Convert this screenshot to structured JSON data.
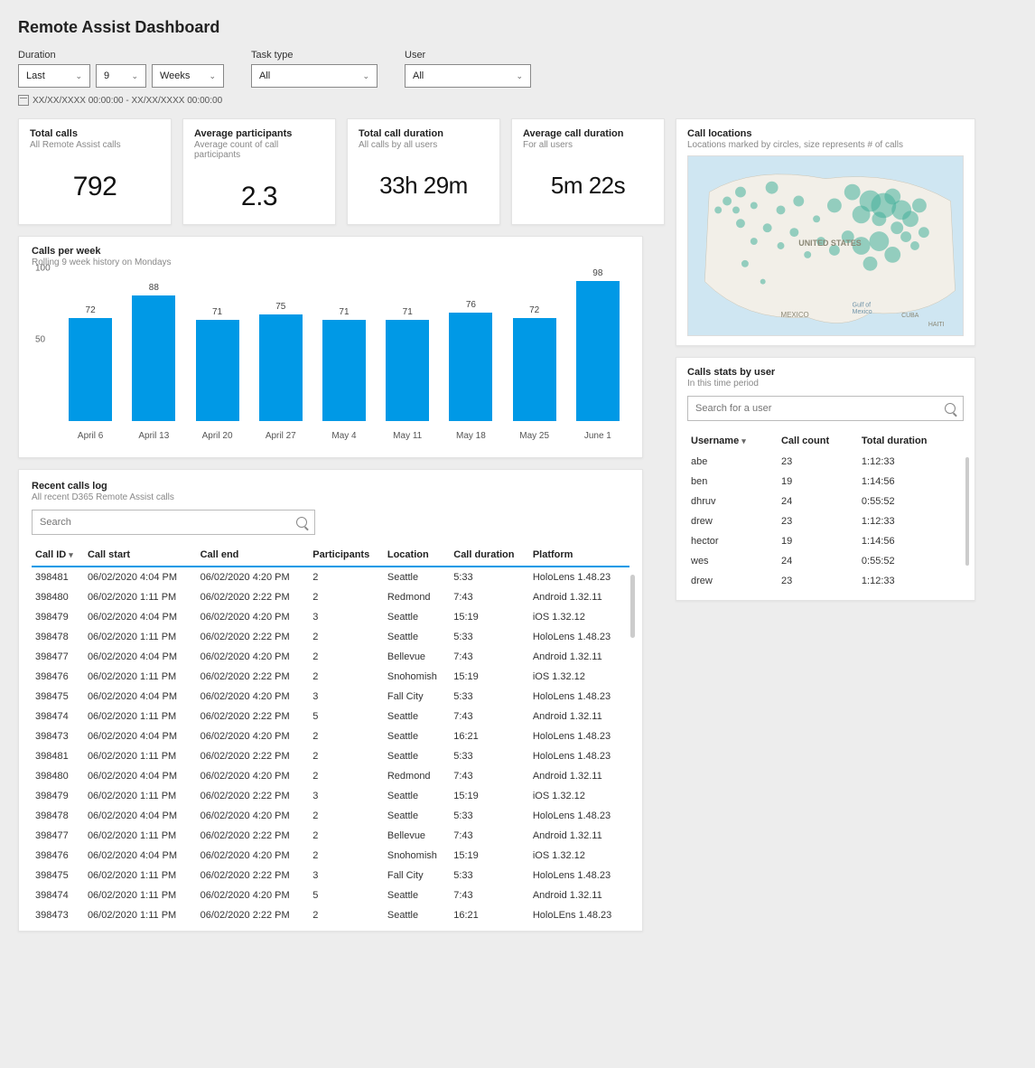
{
  "title": "Remote Assist Dashboard",
  "filters": {
    "duration_label": "Duration",
    "duration_mode": "Last",
    "duration_num": "9",
    "duration_unit": "Weeks",
    "tasktype_label": "Task type",
    "tasktype_val": "All",
    "user_label": "User",
    "user_val": "All"
  },
  "date_range": "XX/XX/XXXX 00:00:00 - XX/XX/XXXX 00:00:00",
  "stats": {
    "total_calls": {
      "title": "Total calls",
      "sub": "All Remote Assist calls",
      "val": "792"
    },
    "avg_part": {
      "title": "Average participants",
      "sub": "Average count of call participants",
      "val": "2.3"
    },
    "total_dur": {
      "title": "Total call duration",
      "sub": "All calls by all users",
      "val": "33h 29m"
    },
    "avg_dur": {
      "title": "Average call duration",
      "sub": "For all users",
      "val": "5m 22s"
    }
  },
  "map": {
    "title": "Call locations",
    "sub": "Locations marked by circles, size represents # of calls",
    "label_us": "UNITED STATES",
    "label_mx": "MEXICO",
    "label_gom": "Gulf of",
    "label_gom2": "Mexico",
    "label_cuba": "CUBA",
    "label_haiti": "HAITI"
  },
  "user_stats": {
    "title": "Calls stats by user",
    "sub": "In this time period",
    "search_ph": "Search for a user",
    "h1": "Username",
    "h2": "Call count",
    "h3": "Total duration",
    "rows": [
      {
        "u": "abe",
        "c": "23",
        "d": "1:12:33"
      },
      {
        "u": "ben",
        "c": "19",
        "d": "1:14:56"
      },
      {
        "u": "dhruv",
        "c": "24",
        "d": "0:55:52"
      },
      {
        "u": "drew",
        "c": "23",
        "d": "1:12:33"
      },
      {
        "u": "hector",
        "c": "19",
        "d": "1:14:56"
      },
      {
        "u": "wes",
        "c": "24",
        "d": "0:55:52"
      },
      {
        "u": "drew",
        "c": "23",
        "d": "1:12:33"
      }
    ]
  },
  "chart": {
    "title": "Calls per week",
    "sub": "Rolling 9 week history on Mondays",
    "ymax": 100,
    "ticks": [
      50,
      100
    ],
    "bars": [
      {
        "x": "April 6",
        "v": 72
      },
      {
        "x": "April 13",
        "v": 88
      },
      {
        "x": "April 20",
        "v": 71
      },
      {
        "x": "April 27",
        "v": 75
      },
      {
        "x": "May 4",
        "v": 71
      },
      {
        "x": "May 11",
        "v": 71
      },
      {
        "x": "May 18",
        "v": 76
      },
      {
        "x": "May 25",
        "v": 72
      },
      {
        "x": "June 1",
        "v": 98
      }
    ]
  },
  "chart_data": {
    "type": "bar",
    "title": "Calls per week",
    "subtitle": "Rolling 9 week history on Mondays",
    "xlabel": "",
    "ylabel": "",
    "ylim": [
      0,
      100
    ],
    "categories": [
      "April 6",
      "April 13",
      "April 20",
      "April 27",
      "May 4",
      "May 11",
      "May 18",
      "May 25",
      "June 1"
    ],
    "values": [
      72,
      88,
      71,
      75,
      71,
      71,
      76,
      72,
      98
    ]
  },
  "log": {
    "title": "Recent calls log",
    "sub": "All recent D365 Remote Assist calls",
    "search_ph": "Search",
    "headers": [
      "Call ID",
      "Call start",
      "Call end",
      "Participants",
      "Location",
      "Call duration",
      "Platform"
    ],
    "rows": [
      [
        "398481",
        "06/02/2020 4:04 PM",
        "06/02/2020 4:20 PM",
        "2",
        "Seattle",
        "5:33",
        "HoloLens 1.48.23"
      ],
      [
        "398480",
        "06/02/2020 1:11 PM",
        "06/02/2020 2:22 PM",
        "2",
        "Redmond",
        "7:43",
        "Android 1.32.11"
      ],
      [
        "398479",
        "06/02/2020 4:04 PM",
        "06/02/2020 4:20 PM",
        "3",
        "Seattle",
        "15:19",
        "iOS 1.32.12"
      ],
      [
        "398478",
        "06/02/2020 1:11 PM",
        "06/02/2020 2:22 PM",
        "2",
        "Seattle",
        "5:33",
        "HoloLens 1.48.23"
      ],
      [
        "398477",
        "06/02/2020 4:04 PM",
        "06/02/2020 4:20 PM",
        "2",
        "Bellevue",
        "7:43",
        "Android 1.32.11"
      ],
      [
        "398476",
        "06/02/2020 1:11 PM",
        "06/02/2020 2:22 PM",
        "2",
        "Snohomish",
        "15:19",
        "iOS 1.32.12"
      ],
      [
        "398475",
        "06/02/2020 4:04 PM",
        "06/02/2020 4:20 PM",
        "3",
        "Fall City",
        "5:33",
        "HoloLens 1.48.23"
      ],
      [
        "398474",
        "06/02/2020 1:11 PM",
        "06/02/2020 2:22 PM",
        "5",
        "Seattle",
        "7:43",
        "Android 1.32.11"
      ],
      [
        "398473",
        "06/02/2020 4:04 PM",
        "06/02/2020 4:20 PM",
        "2",
        "Seattle",
        "16:21",
        "HoloLens 1.48.23"
      ],
      [
        "398481",
        "06/02/2020 1:11 PM",
        "06/02/2020 2:22 PM",
        "2",
        "Seattle",
        "5:33",
        "HoloLens 1.48.23"
      ],
      [
        "398480",
        "06/02/2020 4:04 PM",
        "06/02/2020 4:20 PM",
        "2",
        "Redmond",
        "7:43",
        "Android 1.32.11"
      ],
      [
        "398479",
        "06/02/2020 1:11 PM",
        "06/02/2020 2:22 PM",
        "3",
        "Seattle",
        "15:19",
        "iOS 1.32.12"
      ],
      [
        "398478",
        "06/02/2020 4:04 PM",
        "06/02/2020 4:20 PM",
        "2",
        "Seattle",
        "5:33",
        "HoloLens 1.48.23"
      ],
      [
        "398477",
        "06/02/2020 1:11 PM",
        "06/02/2020 2:22 PM",
        "2",
        "Bellevue",
        "7:43",
        "Android 1.32.11"
      ],
      [
        "398476",
        "06/02/2020 4:04 PM",
        "06/02/2020 4:20 PM",
        "2",
        "Snohomish",
        "15:19",
        "iOS 1.32.12"
      ],
      [
        "398475",
        "06/02/2020 1:11 PM",
        "06/02/2020 2:22 PM",
        "3",
        "Fall City",
        "5:33",
        "HoloLens 1.48.23"
      ],
      [
        "398474",
        "06/02/2020 1:11 PM",
        "06/02/2020 4:20 PM",
        "5",
        "Seattle",
        "7:43",
        "Android 1.32.11"
      ],
      [
        "398473",
        "06/02/2020 1:11 PM",
        "06/02/2020 2:22 PM",
        "2",
        "Seattle",
        "16:21",
        "HoloLEns 1.48.23"
      ]
    ]
  }
}
